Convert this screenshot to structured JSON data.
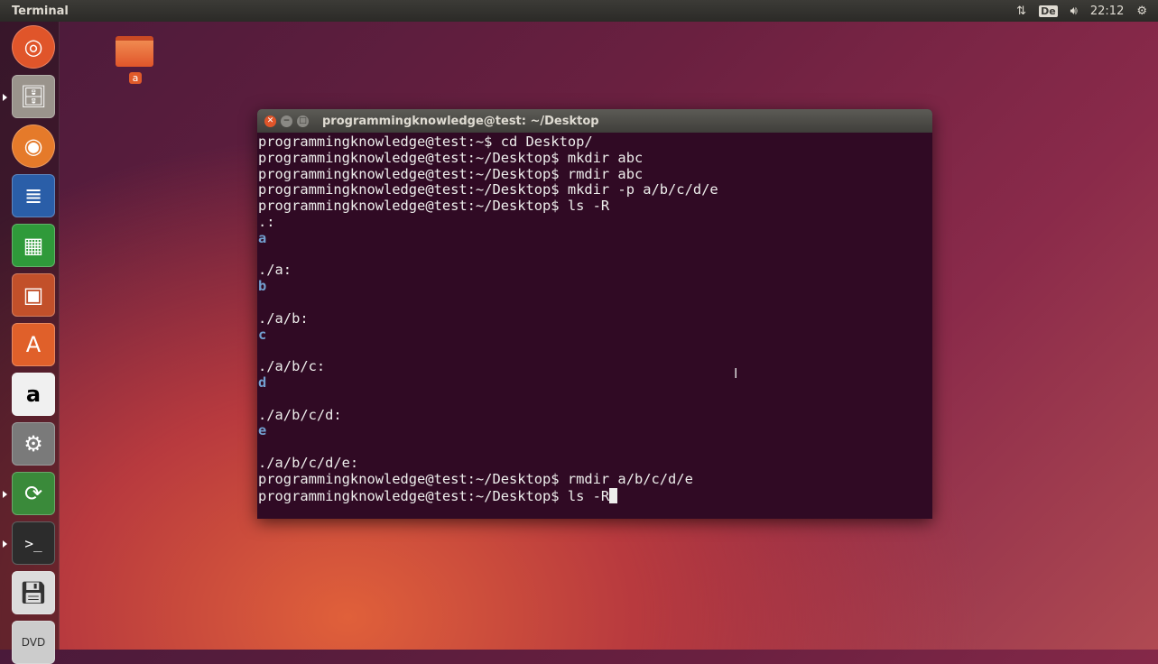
{
  "panel": {
    "title": "Terminal",
    "keyboard": "De",
    "clock": "22:12",
    "icons": [
      "network-arrows-icon",
      "keyboard-layout-icon",
      "volume-icon",
      "power-gear-icon"
    ]
  },
  "launcher": {
    "items": [
      "ubuntu-dash",
      "files",
      "firefox",
      "libreoffice-writer",
      "libreoffice-calc",
      "libreoffice-impress",
      "software-center",
      "amazon",
      "system-settings",
      "software-updater",
      "terminal",
      "save-floppy",
      "dvd"
    ]
  },
  "desktop": {
    "icon_label": "a"
  },
  "terminal": {
    "title": "programmingknowledge@test: ~/Desktop",
    "lines": [
      {
        "t": "programmingknowledge@test:~$ cd Desktop/"
      },
      {
        "t": "programmingknowledge@test:~/Desktop$ mkdir abc"
      },
      {
        "t": "programmingknowledge@test:~/Desktop$ rmdir abc"
      },
      {
        "t": "programmingknowledge@test:~/Desktop$ mkdir -p a/b/c/d/e"
      },
      {
        "t": "programmingknowledge@test:~/Desktop$ ls -R"
      },
      {
        "t": ".:"
      },
      {
        "t": "a",
        "dir": true
      },
      {
        "t": ""
      },
      {
        "t": "./a:"
      },
      {
        "t": "b",
        "dir": true
      },
      {
        "t": ""
      },
      {
        "t": "./a/b:"
      },
      {
        "t": "c",
        "dir": true
      },
      {
        "t": ""
      },
      {
        "t": "./a/b/c:"
      },
      {
        "t": "d",
        "dir": true
      },
      {
        "t": ""
      },
      {
        "t": "./a/b/c/d:"
      },
      {
        "t": "e",
        "dir": true
      },
      {
        "t": ""
      },
      {
        "t": "./a/b/c/d/e:"
      },
      {
        "t": "programmingknowledge@test:~/Desktop$ rmdir a/b/c/d/e"
      },
      {
        "t": "programmingknowledge@test:~/Desktop$ ls -R",
        "cursor": true
      }
    ]
  }
}
